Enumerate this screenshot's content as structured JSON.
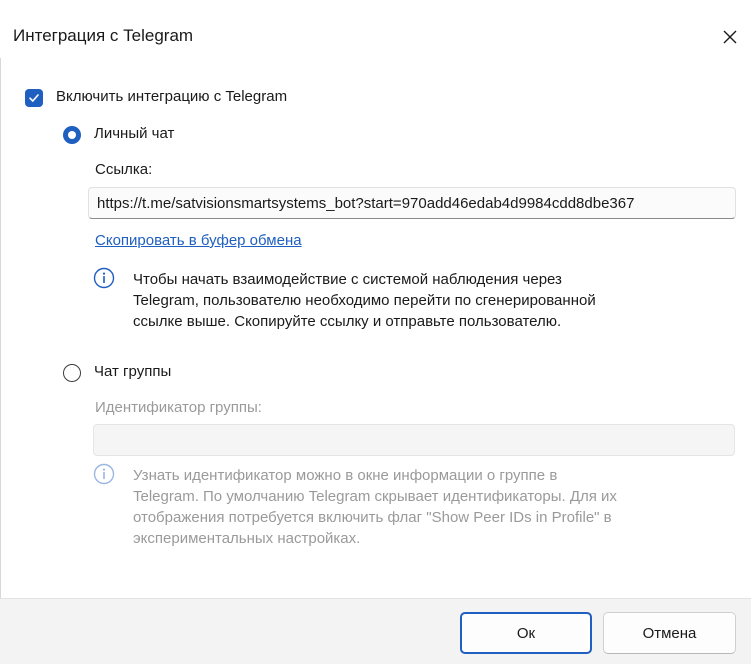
{
  "dialog": {
    "title": "Интеграция с Telegram",
    "close_icon": "close-icon"
  },
  "integration": {
    "enable_label": "Включить интеграцию с Telegram",
    "enabled": true
  },
  "personal_chat": {
    "label": "Личный чат",
    "selected": true,
    "link_label": "Ссылка:",
    "link_value": "https://t.me/satvisionsmartsystems_bot?start=970add46edab4d9984cdd8dbe367",
    "copy_link": "Скопировать в буфер обмена",
    "info_icon": "info-icon",
    "info_lines": [
      "Чтобы начать взаимодействие с системой наблюдения через",
      "Telegram, пользователю необходимо перейти по сгенерированной",
      "ссылке выше. Скопируйте ссылку и отправьте пользователю."
    ]
  },
  "group_chat": {
    "label": "Чат группы",
    "selected": false,
    "id_label": "Идентификатор группы:",
    "id_value": "",
    "info_icon": "info-icon",
    "info_lines": [
      "Узнать идентификатор можно в окне информации о группе в",
      "Telegram. По умолчанию Telegram скрывает идентификаторы. Для их",
      "отображения потребуется включить флаг \"Show Peer IDs in Profile\" в",
      "экспериментальных настройках."
    ]
  },
  "footer": {
    "ok_label": "Ок",
    "cancel_label": "Отмена"
  },
  "colors": {
    "accent": "#1f5fbf",
    "disabled_text": "#9a9a9a",
    "footer_bg": "#f3f3f3"
  }
}
